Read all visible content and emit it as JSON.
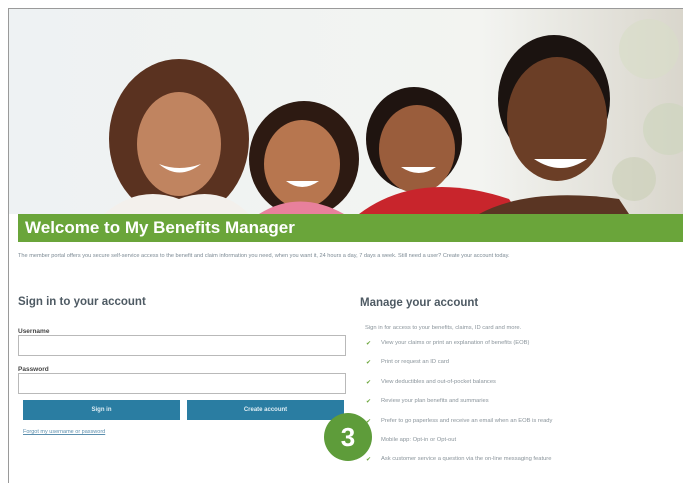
{
  "hero": {
    "image": "family-photo",
    "alt": "Smiling family of four"
  },
  "banner": {
    "title": "Welcome to My Benefits Manager"
  },
  "intro": "The member portal offers you secure self-service access to the benefit and claim information you need, when you want it, 24 hours a day, 7 days a week. Still need a user? Create your account today.",
  "signin": {
    "title": "Sign in to your account",
    "username_label": "Username",
    "username_value": "",
    "password_label": "Password",
    "password_value": "",
    "signin_button": "Sign in",
    "create_button": "Create account",
    "forgot_link": "Forgot my username or password"
  },
  "manage": {
    "title": "Manage your account",
    "subtitle": "Sign in for access to your benefits, claims, ID card and more.",
    "items": [
      {
        "icon": "check-icon",
        "label": "View your claims or print an explanation of benefits (EOB)"
      },
      {
        "icon": "check-icon",
        "label": "Print or request an ID card"
      },
      {
        "icon": "check-icon",
        "label": "View deductibles and out-of-pocket balances"
      },
      {
        "icon": "check-icon",
        "label": "Review your plan benefits and summaries"
      },
      {
        "icon": "check-icon",
        "label": "Prefer to go paperless and receive an email when an EOB is ready"
      },
      {
        "icon": "check-icon",
        "label": "Mobile app: Opt-in or Opt-out"
      },
      {
        "icon": "check-icon",
        "label": "Ask customer service a question via the on-line messaging feature"
      }
    ]
  },
  "step_badge": "3",
  "colors": {
    "brand_green": "#6aa53a",
    "button_blue": "#2a7da2",
    "badge_green": "#5e9c3a"
  }
}
